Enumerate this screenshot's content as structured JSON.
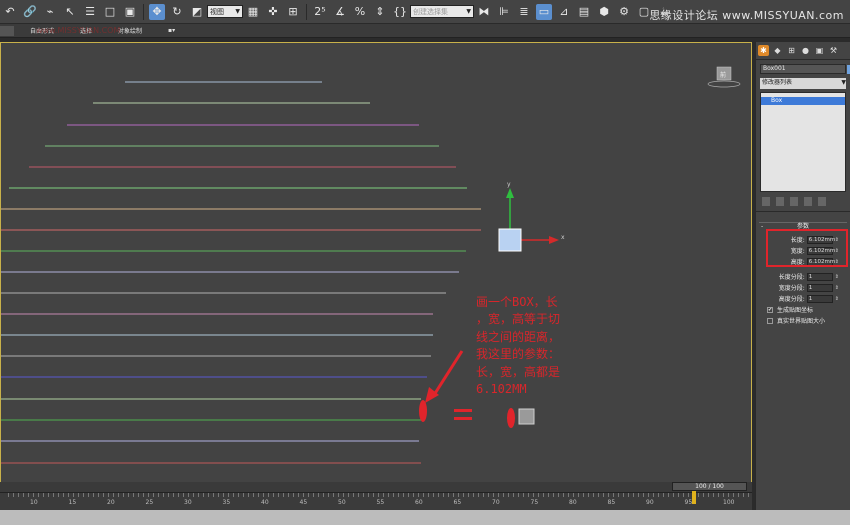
{
  "toolbar": {
    "selection_filter": "视图",
    "named_selection": "创建选择集",
    "watermark": "思缘设计论坛  www.MISSYUAN.com",
    "buttons": [
      "undo-icon",
      "redo-icon",
      "select-link-icon",
      "unlink-icon",
      "bind-spacewarp-icon",
      "select-object-icon",
      "select-by-name-icon",
      "rect-region-icon",
      "window-crossing-icon",
      "move-icon",
      "rotate-icon",
      "scale-icon",
      "pivot-icon",
      "manipulate-icon",
      "snaps-icon",
      "angle-snap-icon",
      "percent-snap-icon",
      "spinner-snap-icon",
      "edit-named-sel-icon",
      "mirror-icon",
      "align-icon",
      "layer-icon",
      "graphite-icon",
      "curve-editor-icon",
      "schematic-icon",
      "material-editor-icon",
      "render-setup-icon",
      "rendered-frame-icon",
      "render-icon"
    ]
  },
  "ribbon2": {
    "items": [
      "自由形式",
      "选择",
      "对象绘制"
    ],
    "lead_watermark": "www.MISSYUAN.COM"
  },
  "viewport": {
    "gizmo_y_label": "y",
    "gizmo_x_label": "x",
    "viewcube_label": "前",
    "annotation": "画一个BOX，长\n，宽，高等于切\n线之间的距离，\n我这里的参数：\n长，宽，高都是\n6.102MM",
    "line_colors": [
      "#a9bcd6",
      "#b6cfa8",
      "#b56bc0",
      "#7fbf7f",
      "#c05a6a",
      "#7fd07f",
      "#d6b38a",
      "#d36a6a",
      "#5bb35b",
      "#b0b0d8",
      "#b0b0b0",
      "#c58ab0",
      "#b0c8d8",
      "#b0b0b0",
      "#5a5ad0",
      "#b0d0a0",
      "#4fb04f",
      "#b0b0e0",
      "#c05a5a"
    ]
  },
  "command_panel": {
    "tabs": [
      "create-tab-icon",
      "modify-tab-icon",
      "hierarchy-tab-icon",
      "motion-tab-icon",
      "display-tab-icon",
      "utilities-tab-icon"
    ],
    "object_name": "Box001",
    "modifier_list": "修改器列表",
    "stack_item": "Box",
    "params_title": "参数",
    "params": [
      {
        "label": "长度:",
        "value": "6.102mm"
      },
      {
        "label": "宽度:",
        "value": "6.102mm"
      },
      {
        "label": "高度:",
        "value": "6.102mm"
      }
    ],
    "segments": [
      {
        "label": "长度分段:",
        "value": "1"
      },
      {
        "label": "宽度分段:",
        "value": "1"
      },
      {
        "label": "高度分段:",
        "value": "1"
      }
    ],
    "checks": [
      {
        "label": "生成贴图坐标",
        "checked": true
      },
      {
        "label": "真实世界贴图大小",
        "checked": false
      }
    ]
  },
  "timeline": {
    "slider_label": "100 / 100",
    "ticks": [
      "10",
      "15",
      "20",
      "25",
      "30",
      "35",
      "40",
      "45",
      "50",
      "55",
      "60",
      "65",
      "70",
      "75",
      "80",
      "85",
      "90",
      "95",
      "100"
    ]
  }
}
